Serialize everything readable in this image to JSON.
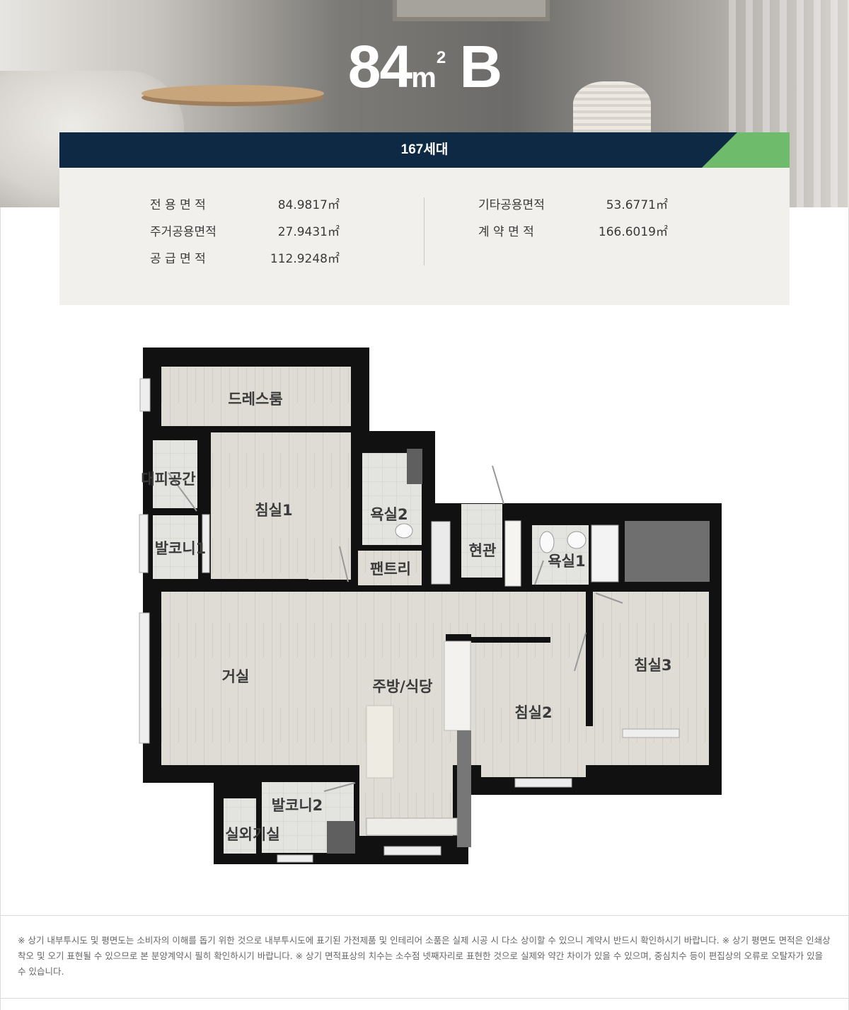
{
  "header": {
    "size_number": "84",
    "size_unit": "m",
    "size_sup": "2",
    "type_letter": "B"
  },
  "households": "167세대",
  "areas": {
    "left": [
      {
        "label": "전 용 면 적",
        "value": "84.9817㎡"
      },
      {
        "label": "주거공용면적",
        "value": "27.9431㎡"
      },
      {
        "label": "공 급 면 적",
        "value": "112.9248㎡"
      }
    ],
    "right": [
      {
        "label": "기타공용면적",
        "value": "53.6771㎡"
      },
      {
        "label": "계 약 면 적",
        "value": "166.6019㎡"
      }
    ]
  },
  "rooms": {
    "dressroom": "드레스룸",
    "evacuation": "대피공간",
    "balcony1": "발코니1",
    "bedroom1": "침실1",
    "bath2": "욕실2",
    "pantry": "팬트리",
    "entrance": "현관",
    "bath1": "욕실1",
    "living": "거실",
    "kitchen": "주방/식당",
    "bedroom2": "침실2",
    "bedroom3": "침실3",
    "balcony2": "발코니2",
    "outdoor_unit": "실외기실"
  },
  "colors": {
    "navy": "#0e2944",
    "green_accent": "#6dbb6b",
    "panel_bg": "#f1f0ed",
    "wall": "#111111",
    "floor": "#dcdad2"
  },
  "notes": "※ 상기 내부투시도 및 평면도는 소비자의 이해를 돕기 위한 것으로 내부투시도에 표기된 가전제품 및 인테리어 소품은 실제 시공 시 다소 상이할 수 있으니 계약시 반드시 확인하시기 바랍니다. ※ 상기 평면도 면적은 인쇄상 착오 및 오기 표현될 수 있으므로 본 분양계약시 필히 확인하시기 바랍니다. ※ 상기 면적표상의 치수는 소수점 넷째자리로 표현한 것으로 실제와 약간 차이가 있을 수 있으며, 중심치수 등이 편집상의 오류로 오탈자가 있을 수 있습니다."
}
